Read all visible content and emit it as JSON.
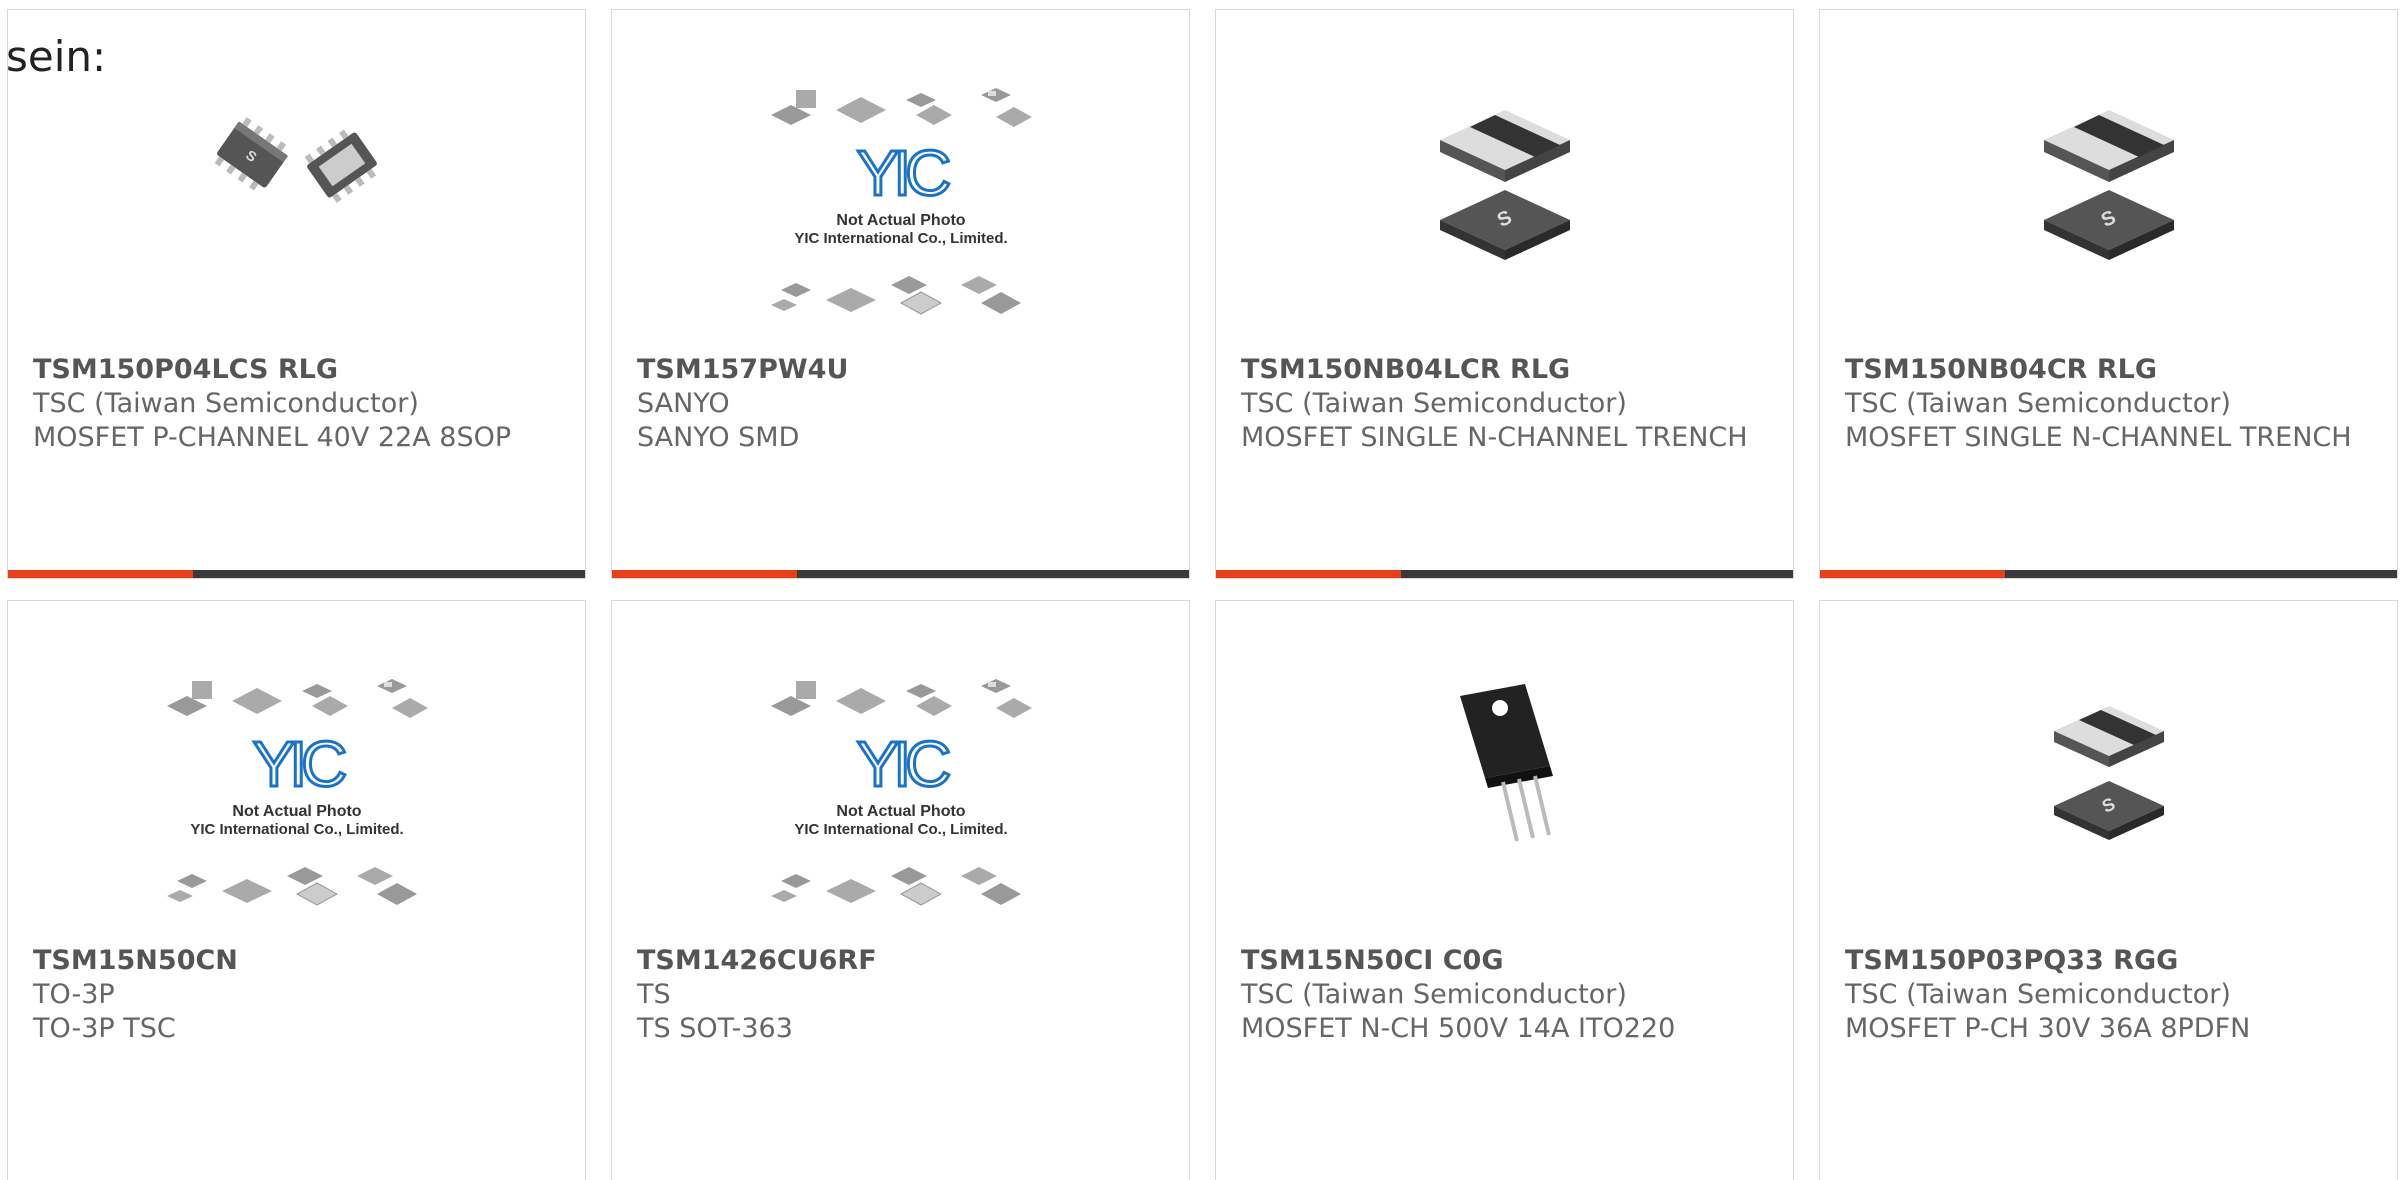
{
  "intro_text": "sein:",
  "placeholder": {
    "brand": "YIC",
    "line1": "Not Actual Photo",
    "line2": "YIC International Co., Limited."
  },
  "colors": {
    "accent": "#e8401c",
    "bar": "#3a3a3a",
    "border": "#d9d9d9",
    "placeholder_blue": "#1a73c8"
  },
  "products": [
    {
      "part_number": "TSM150P04LCS RLG",
      "manufacturer": "TSC (Taiwan Semiconductor)",
      "description": "MOSFET P-CHANNEL 40V 22A 8SOP",
      "image": "sop8-chip"
    },
    {
      "part_number": "TSM157PW4U",
      "manufacturer": "SANYO",
      "description": "SANYO SMD",
      "image": "yic-placeholder"
    },
    {
      "part_number": "TSM150NB04LCR RLG",
      "manufacturer": "TSC (Taiwan Semiconductor)",
      "description": "MOSFET SINGLE N-CHANNEL TRENCH",
      "image": "pdfn-chip"
    },
    {
      "part_number": "TSM150NB04CR RLG",
      "manufacturer": "TSC (Taiwan Semiconductor)",
      "description": "MOSFET SINGLE N-CHANNEL TRENCH",
      "image": "pdfn-chip"
    },
    {
      "part_number": "TSM15N50CN",
      "manufacturer": "TO-3P",
      "description": "TO-3P TSC",
      "image": "yic-placeholder"
    },
    {
      "part_number": "TSM1426CU6RF",
      "manufacturer": "TS",
      "description": "TS SOT-363",
      "image": "yic-placeholder"
    },
    {
      "part_number": "TSM15N50CI C0G",
      "manufacturer": "TSC (Taiwan Semiconductor)",
      "description": "MOSFET N-CH 500V 14A ITO220",
      "image": "to220-chip"
    },
    {
      "part_number": "TSM150P03PQ33 RGG",
      "manufacturer": "TSC (Taiwan Semiconductor)",
      "description": "MOSFET P-CH 30V 36A 8PDFN",
      "image": "pdfn-chip"
    }
  ]
}
